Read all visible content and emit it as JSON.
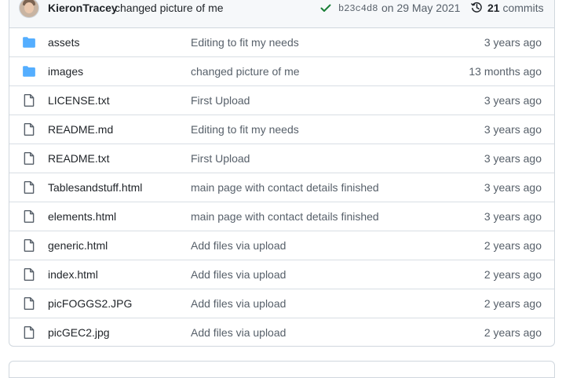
{
  "commit_bar": {
    "author": "KieronTracey",
    "message": "changed picture of me",
    "sha": "b23c4d8",
    "date": "on 29 May 2021",
    "commit_count": "21",
    "commits_label": "commits",
    "check_color": "#1a7f37"
  },
  "files": [
    {
      "type": "folder",
      "icon": "folder-icon",
      "name": "assets",
      "message": "Editing to fit my needs",
      "age": "3 years ago"
    },
    {
      "type": "folder",
      "icon": "folder-icon",
      "name": "images",
      "message": "changed picture of me",
      "age": "13 months ago"
    },
    {
      "type": "file",
      "icon": "file-icon",
      "name": "LICENSE.txt",
      "message": "First Upload",
      "age": "3 years ago"
    },
    {
      "type": "file",
      "icon": "file-icon",
      "name": "README.md",
      "message": "Editing to fit my needs",
      "age": "3 years ago"
    },
    {
      "type": "file",
      "icon": "file-icon",
      "name": "README.txt",
      "message": "First Upload",
      "age": "3 years ago"
    },
    {
      "type": "file",
      "icon": "file-icon",
      "name": "Tablesandstuff.html",
      "message": "main page with contact details finished",
      "age": "3 years ago"
    },
    {
      "type": "file",
      "icon": "file-icon",
      "name": "elements.html",
      "message": "main page with contact details finished",
      "age": "3 years ago"
    },
    {
      "type": "file",
      "icon": "file-icon",
      "name": "generic.html",
      "message": "Add files via upload",
      "age": "2 years ago"
    },
    {
      "type": "file",
      "icon": "file-icon",
      "name": "index.html",
      "message": "Add files via upload",
      "age": "2 years ago"
    },
    {
      "type": "file",
      "icon": "file-icon",
      "name": "picFOGGS2.JPG",
      "message": "Add files via upload",
      "age": "2 years ago"
    },
    {
      "type": "file",
      "icon": "file-icon",
      "name": "picGEC2.jpg",
      "message": "Add files via upload",
      "age": "2 years ago"
    }
  ],
  "colors": {
    "folder": "#54aeff",
    "file_icon": "#57606a",
    "border": "#d0d7de"
  }
}
